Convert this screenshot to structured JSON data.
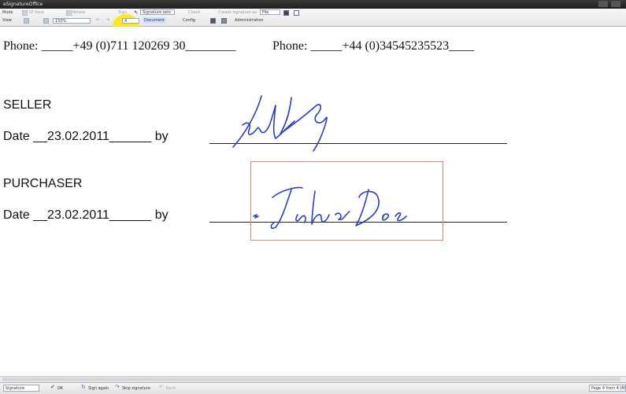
{
  "window": {
    "title": "eSignatureOffice"
  },
  "toolbar": {
    "mode_label": "Mode",
    "view_label": "View",
    "id_view": "ID View",
    "rotate": "Rotate",
    "sign": "Sign",
    "signature_sets": "Signature sets",
    "check": "Check",
    "create_signature_as": "Create signature as",
    "file_option": "File",
    "zoom_value": "150%",
    "page_value": "4",
    "document_label": "Document",
    "config": "Config",
    "administration": "Administration"
  },
  "document": {
    "phone_left": "Phone: _____+49 (0)711 120269 30________",
    "phone_right": "Phone: _____+44 (0)34545235523____",
    "seller_label": "SELLER",
    "seller_date": "Date __23.02.2011______ by",
    "purchaser_label": "PURCHASER",
    "purchaser_date": "Date __23.02.2011______ by",
    "purchaser_signature": "John Doe"
  },
  "statusbar": {
    "signature_field": "Signature",
    "ok": "OK",
    "sign_again": "Sign again",
    "skip_signature": "Skip signature",
    "back": "Back",
    "page_info": "Page 4 from 4  (Mo"
  },
  "colors": {
    "ink": "#2a3fc8",
    "sig_box": "#e08080",
    "highlight": "#ffe600"
  }
}
